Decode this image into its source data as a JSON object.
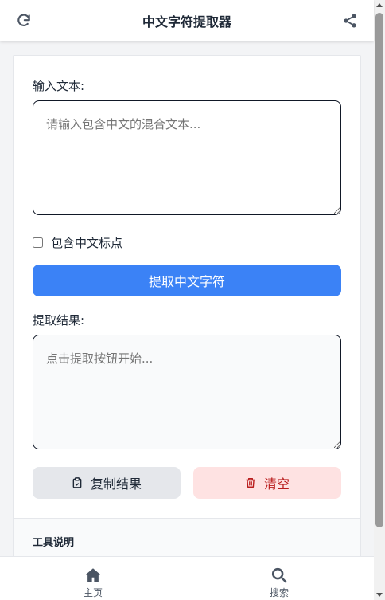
{
  "header": {
    "title": "中文字符提取器",
    "left_icon": "refresh-icon",
    "right_icon": "share-icon"
  },
  "form": {
    "input_label": "输入文本:",
    "input_placeholder": "请输入包含中文的混合文本...",
    "input_value": "",
    "punctuation_checkbox_label": "包含中文标点",
    "punctuation_checked": false,
    "extract_button": "提取中文字符",
    "result_label": "提取结果:",
    "result_placeholder": "点击提取按钮开始...",
    "result_value": "",
    "copy_button": "复制结果",
    "copy_icon": "clipboard-icon",
    "clear_button": "清空",
    "clear_icon": "trash-icon"
  },
  "info": {
    "heading": "工具说明"
  },
  "bottom_nav": {
    "items": [
      {
        "label": "主页",
        "icon": "home-icon"
      },
      {
        "label": "搜索",
        "icon": "search-icon"
      }
    ]
  },
  "colors": {
    "primary": "#3b82f6",
    "danger_bg": "#fee2e2",
    "danger_text": "#b91c1c",
    "neutral_btn": "#e5e7eb"
  }
}
